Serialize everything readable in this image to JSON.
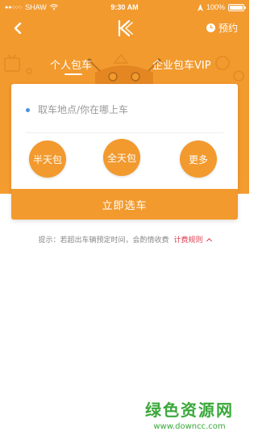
{
  "status_bar": {
    "carrier": "SHAW",
    "time": "9:30 AM",
    "battery": "100%",
    "battery_level": 1.0
  },
  "nav": {
    "back_icon": "chevron-left-icon",
    "logo_icon": "k-logo-icon",
    "reserve_label": "预约",
    "reserve_icon": "clock-icon"
  },
  "tabs": [
    {
      "label": "个人包车",
      "active": true
    },
    {
      "label": "企业包车VIP",
      "active": false
    }
  ],
  "card": {
    "pickup_placeholder": "取车地点/你在哪上车",
    "options": [
      {
        "label": "半天包"
      },
      {
        "label": "全天包"
      },
      {
        "label": "更多"
      }
    ],
    "select_button": "立即选车"
  },
  "tip": {
    "text": "提示：若超出车辆预定时间，会酌情收费",
    "link": "计费规则"
  },
  "watermark": {
    "title": "绿色资源网",
    "url": "www.downcc.com"
  },
  "colors": {
    "accent": "#f29a2e",
    "link": "#e03a4c",
    "watermark": "#3aa83a"
  }
}
